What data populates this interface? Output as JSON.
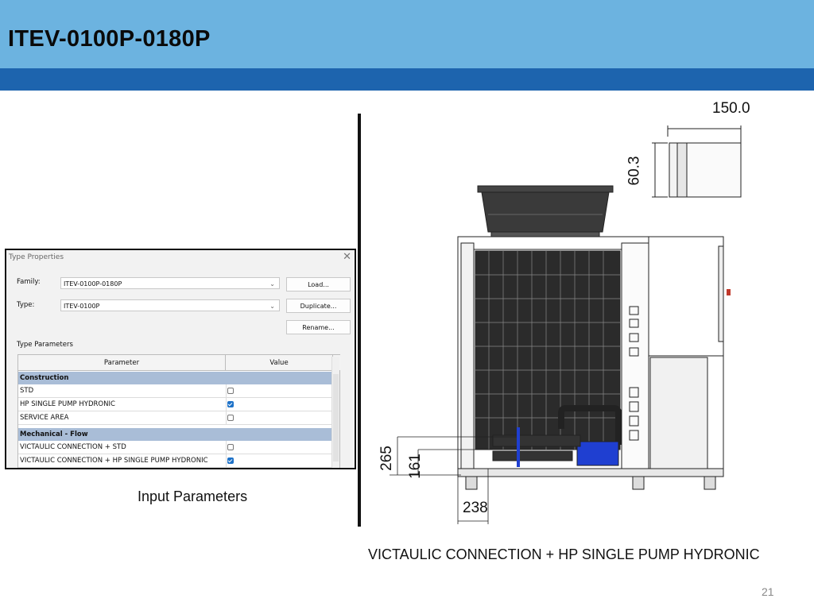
{
  "slide": {
    "title": "ITEV-0100P-0180P",
    "caption_left": "Input Parameters",
    "caption_right": "VICTAULIC CONNECTION + HP SINGLE PUMP HYDRONIC",
    "page_number": "21",
    "colors": {
      "header": "#6cb3e0",
      "header_bar": "#1d64ae",
      "group_row": "#a9bdd7",
      "checkbox_checked": "#1e72c8"
    }
  },
  "dialog": {
    "title": "Type Properties",
    "close_icon": "close-icon",
    "family_label": "Family:",
    "family_value": "ITEV-0100P-0180P",
    "type_label": "Type:",
    "type_value": "ITEV-0100P",
    "buttons": {
      "load": "Load...",
      "duplicate": "Duplicate...",
      "rename": "Rename..."
    },
    "type_parameters_label": "Type Parameters",
    "columns": {
      "parameter": "Parameter",
      "value": "Value",
      "extra": "="
    },
    "groups": [
      {
        "name": "Construction",
        "collapse_icon": "^",
        "rows": [
          {
            "label": "STD",
            "checked": false
          },
          {
            "label": "HP SINGLE PUMP HYDRONIC",
            "checked": true
          },
          {
            "label": "SERVICE AREA",
            "checked": false
          }
        ]
      },
      {
        "name": "Mechanical - Flow",
        "collapse_icon": "^",
        "rows": [
          {
            "label": "VICTAULIC CONNECTION + STD",
            "checked": false
          },
          {
            "label": "VICTAULIC CONNECTION + HP SINGLE PUMP HYDRONIC",
            "checked": true
          }
        ]
      }
    ]
  },
  "dimensions": {
    "pipe_length": "150.0",
    "pipe_diameter": "60.3",
    "outlet_height": "265",
    "inlet_height": "161",
    "connection_offset": "238"
  }
}
